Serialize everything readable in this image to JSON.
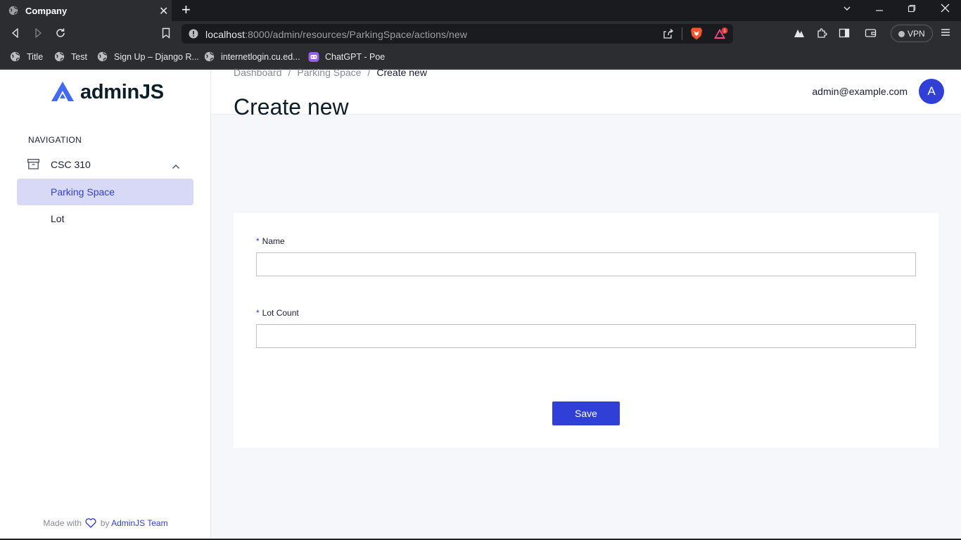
{
  "browser": {
    "tab_title": "Company",
    "url_host": "localhost",
    "url_rest": ":8000/admin/resources/ParkingSpace/actions/new",
    "vpn_label": "VPN",
    "brave_badge": "1",
    "bookmarks": [
      {
        "label": "Title",
        "icon": "globe-icon"
      },
      {
        "label": "Test",
        "icon": "globe-icon"
      },
      {
        "label": "Sign Up – Django R...",
        "icon": "globe-icon"
      },
      {
        "label": "internetlogin.cu.ed...",
        "icon": "globe-icon"
      },
      {
        "label": "ChatGPT - Poe",
        "icon": "poe-icon"
      }
    ]
  },
  "sidebar": {
    "logo_text": "adminJS",
    "nav_heading": "NAVIGATION",
    "group_label": "CSC 310",
    "items": [
      {
        "label": "Parking Space",
        "active": true
      },
      {
        "label": "Lot",
        "active": false
      }
    ],
    "footer": {
      "prefix": "Made with",
      "by": "by",
      "team": "AdminJS Team"
    }
  },
  "header": {
    "email": "admin@example.com",
    "avatar_initial": "A"
  },
  "breadcrumb": {
    "items": [
      "Dashboard",
      "Parking Space",
      "Create new"
    ]
  },
  "page": {
    "title": "Create new"
  },
  "form": {
    "fields": [
      {
        "label": "Name",
        "value": "",
        "required": true
      },
      {
        "label": "Lot Count",
        "value": "",
        "required": true
      }
    ],
    "required_mark": "*",
    "save_label": "Save"
  },
  "colors": {
    "primary": "#3040d6",
    "active_bg": "#d7d9f7",
    "text": "#1c1c38"
  }
}
